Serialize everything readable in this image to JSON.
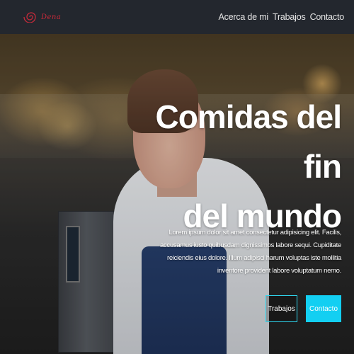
{
  "brand": {
    "logo_text": "Dena",
    "logo_color": "#c62a3a"
  },
  "nav": {
    "items": [
      {
        "label": "Acerca de mi"
      },
      {
        "label": "Trabajos"
      },
      {
        "label": "Contacto"
      }
    ]
  },
  "hero": {
    "title_line1": "Comidas del fin",
    "title_line2": "del mundo",
    "description": "Lorem ipsum dolor sit amet consectetur adipisicing elit. Facilis, accusamus iusto quibusdam dignissimos labore sequi. Cupiditate reiciendis eius dolore. Illum adipisci harum voluptas iste mollitia inventore provident labore voluptatum nemo.",
    "btn_secondary": "Trabajos",
    "btn_primary": "Contacto",
    "accent_color": "#13cff2"
  }
}
